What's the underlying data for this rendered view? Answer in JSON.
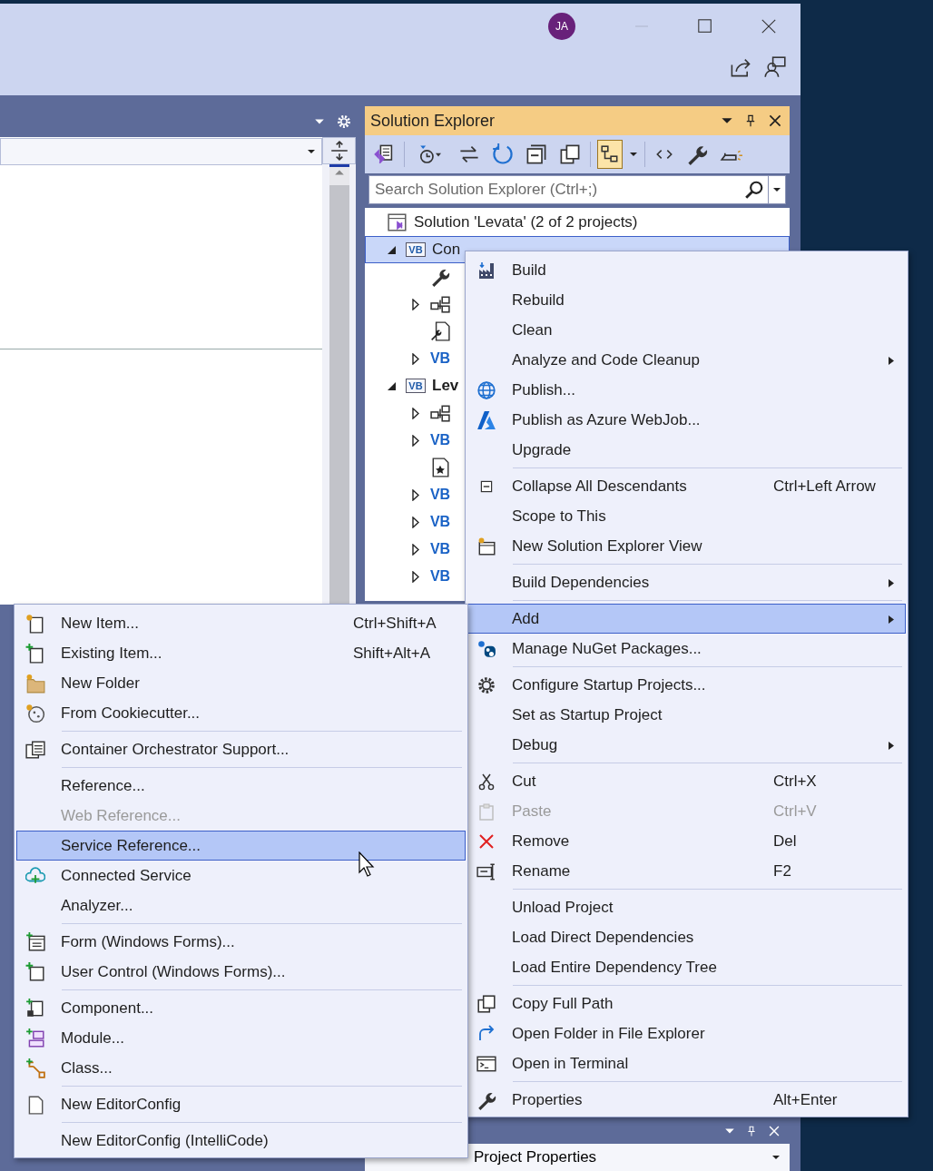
{
  "window": {
    "account_initials": "JA"
  },
  "solution_explorer": {
    "title": "Solution Explorer",
    "toolbar_buttons": [
      {
        "kind": "switch",
        "selected": false
      },
      {
        "kind": "history",
        "selected": false
      },
      {
        "kind": "sync",
        "selected": false
      },
      {
        "kind": "refresh",
        "selected": false
      },
      {
        "kind": "collapse",
        "selected": false
      },
      {
        "kind": "copies",
        "selected": false
      },
      {
        "kind": "show-all",
        "selected": true
      },
      {
        "kind": "code",
        "selected": false
      },
      {
        "kind": "properties",
        "selected": false
      },
      {
        "kind": "preview",
        "selected": false
      }
    ],
    "search": {
      "placeholder": "Search Solution Explorer (Ctrl+;)"
    },
    "tree": [
      {
        "kind": "solution",
        "label": "Solution 'Levata' (2 of 2 projects)",
        "selected": false,
        "children": [
          {
            "kind": "project",
            "badge": "VB",
            "label": "Con",
            "expanded": true,
            "selected": true,
            "children": [
              {
                "kind": "wrench",
                "selected": false
              },
              {
                "kind": "refs",
                "expanded": false,
                "selected": false
              },
              {
                "kind": "config",
                "selected": false
              },
              {
                "kind": "vb",
                "badge": "VB",
                "expanded": false,
                "selected": false
              }
            ]
          },
          {
            "kind": "project",
            "badge": "VB",
            "label": "Lev",
            "expanded": true,
            "selected": false,
            "children": [
              {
                "kind": "refs",
                "expanded": false,
                "selected": false
              },
              {
                "kind": "vb",
                "badge": "VB",
                "expanded": false,
                "selected": false
              },
              {
                "kind": "resx",
                "selected": false
              },
              {
                "kind": "vb",
                "badge": "VB",
                "expanded": false,
                "selected": false
              },
              {
                "kind": "vb",
                "badge": "VB",
                "expanded": false,
                "selected": false
              },
              {
                "kind": "vb",
                "badge": "VB",
                "expanded": false,
                "selected": false
              },
              {
                "kind": "vb",
                "badge": "VB",
                "expanded": false,
                "selected": false
              }
            ]
          }
        ]
      }
    ]
  },
  "context_menu": {
    "groups": [
      [
        {
          "label": "Build",
          "selected": false,
          "disabled": false
        },
        {
          "label": "Rebuild",
          "selected": false,
          "disabled": false
        },
        {
          "label": "Clean",
          "selected": false,
          "disabled": false
        },
        {
          "label": "Analyze and Code Cleanup",
          "submenu": true,
          "selected": false,
          "disabled": false
        },
        {
          "label": "Publish...",
          "selected": false,
          "disabled": false
        },
        {
          "label": "Publish as Azure WebJob...",
          "selected": false,
          "disabled": false
        },
        {
          "label": "Upgrade",
          "selected": false,
          "disabled": false
        }
      ],
      [
        {
          "label": "Collapse All Descendants",
          "shortcut": "Ctrl+Left Arrow",
          "selected": false,
          "disabled": false
        },
        {
          "label": "Scope to This",
          "selected": false,
          "disabled": false
        },
        {
          "label": "New Solution Explorer View",
          "selected": false,
          "disabled": false
        }
      ],
      [
        {
          "label": "Build Dependencies",
          "submenu": true,
          "selected": false,
          "disabled": false
        }
      ],
      [
        {
          "label": "Add",
          "submenu": true,
          "selected": true,
          "disabled": false
        },
        {
          "label": "Manage NuGet Packages...",
          "selected": false,
          "disabled": false
        }
      ],
      [
        {
          "label": "Configure Startup Projects...",
          "selected": false,
          "disabled": false
        },
        {
          "label": "Set as Startup Project",
          "selected": false,
          "disabled": false
        },
        {
          "label": "Debug",
          "submenu": true,
          "selected": false,
          "disabled": false
        }
      ],
      [
        {
          "label": "Cut",
          "shortcut": "Ctrl+X",
          "selected": false,
          "disabled": false
        },
        {
          "label": "Paste",
          "shortcut": "Ctrl+V",
          "selected": false,
          "disabled": true
        },
        {
          "label": "Remove",
          "shortcut": "Del",
          "selected": false,
          "disabled": false
        },
        {
          "label": "Rename",
          "shortcut": "F2",
          "selected": false,
          "disabled": false
        }
      ],
      [
        {
          "label": "Unload Project",
          "selected": false,
          "disabled": false
        },
        {
          "label": "Load Direct Dependencies",
          "selected": false,
          "disabled": false
        },
        {
          "label": "Load Entire Dependency Tree",
          "selected": false,
          "disabled": false
        }
      ],
      [
        {
          "label": "Copy Full Path",
          "selected": false,
          "disabled": false
        },
        {
          "label": "Open Folder in File Explorer",
          "selected": false,
          "disabled": false
        },
        {
          "label": "Open in Terminal",
          "selected": false,
          "disabled": false
        }
      ],
      [
        {
          "label": "Properties",
          "shortcut": "Alt+Enter",
          "selected": false,
          "disabled": false
        }
      ]
    ]
  },
  "add_submenu": {
    "groups": [
      [
        {
          "label": "New Item...",
          "shortcut": "Ctrl+Shift+A",
          "selected": false,
          "disabled": false
        },
        {
          "label": "Existing Item...",
          "shortcut": "Shift+Alt+A",
          "selected": false,
          "disabled": false
        },
        {
          "label": "New Folder",
          "selected": false,
          "disabled": false
        },
        {
          "label": "From Cookiecutter...",
          "selected": false,
          "disabled": false
        }
      ],
      [
        {
          "label": "Container Orchestrator Support...",
          "selected": false,
          "disabled": false
        }
      ],
      [
        {
          "label": "Reference...",
          "selected": false,
          "disabled": false
        },
        {
          "label": "Web Reference...",
          "selected": false,
          "disabled": true
        },
        {
          "label": "Service Reference...",
          "selected": true,
          "disabled": false
        },
        {
          "label": "Connected Service",
          "selected": false,
          "disabled": false
        },
        {
          "label": "Analyzer...",
          "selected": false,
          "disabled": false
        }
      ],
      [
        {
          "label": "Form (Windows Forms)...",
          "selected": false,
          "disabled": false
        },
        {
          "label": "User Control (Windows Forms)...",
          "selected": false,
          "disabled": false
        }
      ],
      [
        {
          "label": "Component...",
          "selected": false,
          "disabled": false
        },
        {
          "label": "Module...",
          "selected": false,
          "disabled": false
        },
        {
          "label": "Class...",
          "selected": false,
          "disabled": false
        }
      ],
      [
        {
          "label": "New EditorConfig",
          "selected": false,
          "disabled": false
        }
      ],
      [
        {
          "label": "New EditorConfig (IntelliCode)",
          "selected": false,
          "disabled": false
        }
      ]
    ]
  },
  "properties_panel": {
    "type": "Project Properties"
  }
}
